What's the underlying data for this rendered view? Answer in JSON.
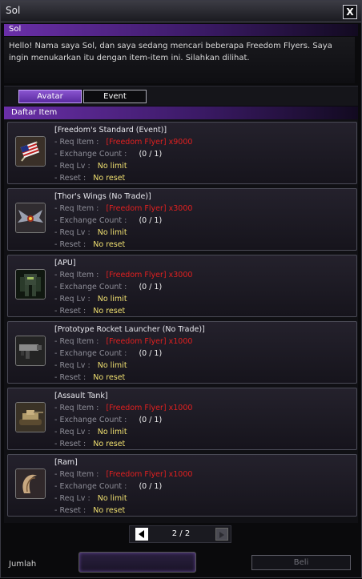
{
  "window": {
    "title": "Sol",
    "close_label": "X"
  },
  "npc": {
    "name": "Sol",
    "dialog": "Hello! Nama saya Sol, dan saya sedang mencari beberapa Freedom Flyers. Saya ingin menukarkan itu dengan item-item ini. Silahkan dilihat."
  },
  "tabs": [
    {
      "label": "Avatar",
      "active": true
    },
    {
      "label": "Event",
      "active": false
    }
  ],
  "list": {
    "header": "Daftar Item",
    "field_labels": {
      "req_item": "- Req Item :",
      "exchange_count": "- Exchange Count :",
      "req_lv": "- Req Lv :",
      "reset": "- Reset :"
    },
    "items": [
      {
        "name": "[Freedom's Standard (Event)]",
        "req_item": "[Freedom Flyer] x9000",
        "exchange_count": "(0 / 1)",
        "req_lv": "No limit",
        "reset": "No reset",
        "icon": "flag-icon"
      },
      {
        "name": "[Thor's Wings (No Trade)]",
        "req_item": "[Freedom Flyer] x3000",
        "exchange_count": "(0 / 1)",
        "req_lv": "No limit",
        "reset": "No reset",
        "icon": "wings-icon"
      },
      {
        "name": "[APU]",
        "req_item": "[Freedom Flyer] x3000",
        "exchange_count": "(0 / 1)",
        "req_lv": "No limit",
        "reset": "No reset",
        "icon": "mech-icon"
      },
      {
        "name": "[Prototype Rocket Launcher (No Trade)]",
        "req_item": "[Freedom Flyer] x1000",
        "exchange_count": "(0 / 1)",
        "req_lv": "No limit",
        "reset": "No reset",
        "icon": "rocket-launcher-icon"
      },
      {
        "name": "[Assault Tank]",
        "req_item": "[Freedom Flyer] x1000",
        "exchange_count": "(0 / 1)",
        "req_lv": "No limit",
        "reset": "No reset",
        "icon": "tank-icon"
      },
      {
        "name": "[Ram]",
        "req_item": "[Freedom Flyer] x1000",
        "exchange_count": "(0 / 1)",
        "req_lv": "No limit",
        "reset": "No reset",
        "icon": "ram-horn-icon"
      }
    ]
  },
  "pager": {
    "text": "2 / 2"
  },
  "footer": {
    "quantity_label": "Jumlah",
    "quantity_value": "",
    "buy_label": "Beli"
  },
  "colors": {
    "accent": "#6a2fa8",
    "req_item": "#e02020",
    "value": "#f0e070"
  }
}
